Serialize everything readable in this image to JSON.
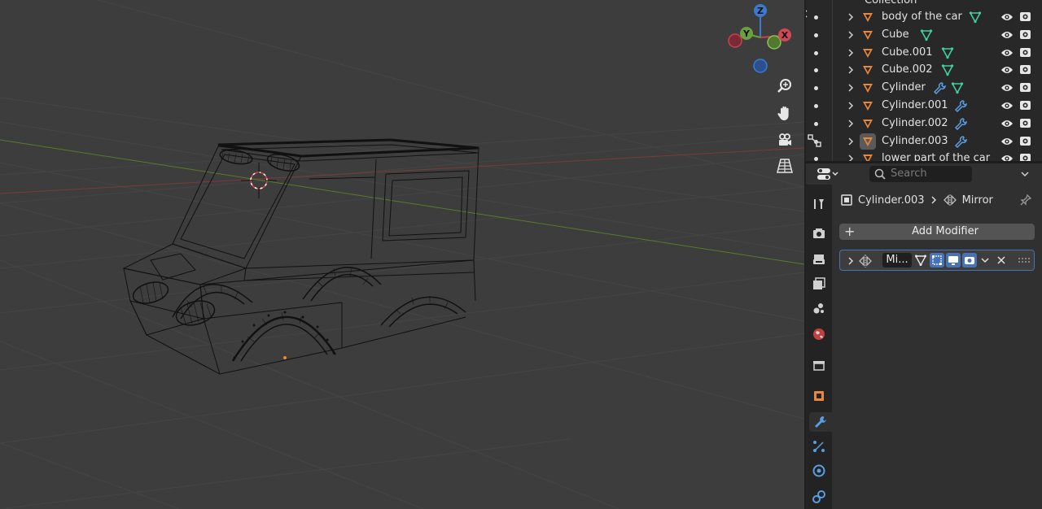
{
  "outliner": {
    "collection_label": "Collection",
    "rows": [
      {
        "label": "body of the car",
        "extras": [
          "mesh"
        ],
        "active": false
      },
      {
        "label": "Cube",
        "extras": [
          "mesh"
        ],
        "active": false
      },
      {
        "label": "Cube.001",
        "extras": [
          "mesh"
        ],
        "active": false
      },
      {
        "label": "Cube.002",
        "extras": [
          "mesh"
        ],
        "active": false
      },
      {
        "label": "Cylinder",
        "extras": [
          "modifier",
          "mesh"
        ],
        "active": false
      },
      {
        "label": "Cylinder.001",
        "extras": [
          "modifier"
        ],
        "active": false
      },
      {
        "label": "Cylinder.002",
        "extras": [
          "modifier"
        ],
        "active": false
      },
      {
        "label": "Cylinder.003",
        "extras": [
          "modifier"
        ],
        "active": true
      },
      {
        "label": "lower part of the car",
        "extras": [],
        "active": false
      }
    ]
  },
  "properties": {
    "search_placeholder": "Search",
    "breadcrumb_object": "Cylinder.003",
    "breadcrumb_modifier": "Mirror",
    "add_modifier_label": "Add Modifier",
    "modifier_name": "Mi...",
    "tabs": [
      "tool-icon",
      "render-icon",
      "output-icon",
      "view-layer-icon",
      "scene-icon",
      "world-icon",
      "collection-icon",
      "object-icon",
      "modifier-icon",
      "particles-icon",
      "physics-icon",
      "constraints-icon"
    ],
    "active_tab": "modifier-icon"
  },
  "gizmo": {
    "x_label": "X",
    "y_label": "Y",
    "z_label": "Z"
  },
  "colors": {
    "accent": "#4772b3",
    "object_orange": "#e8883a",
    "mesh_green": "#3fd0a0",
    "modifier_blue": "#5a9ee0"
  }
}
